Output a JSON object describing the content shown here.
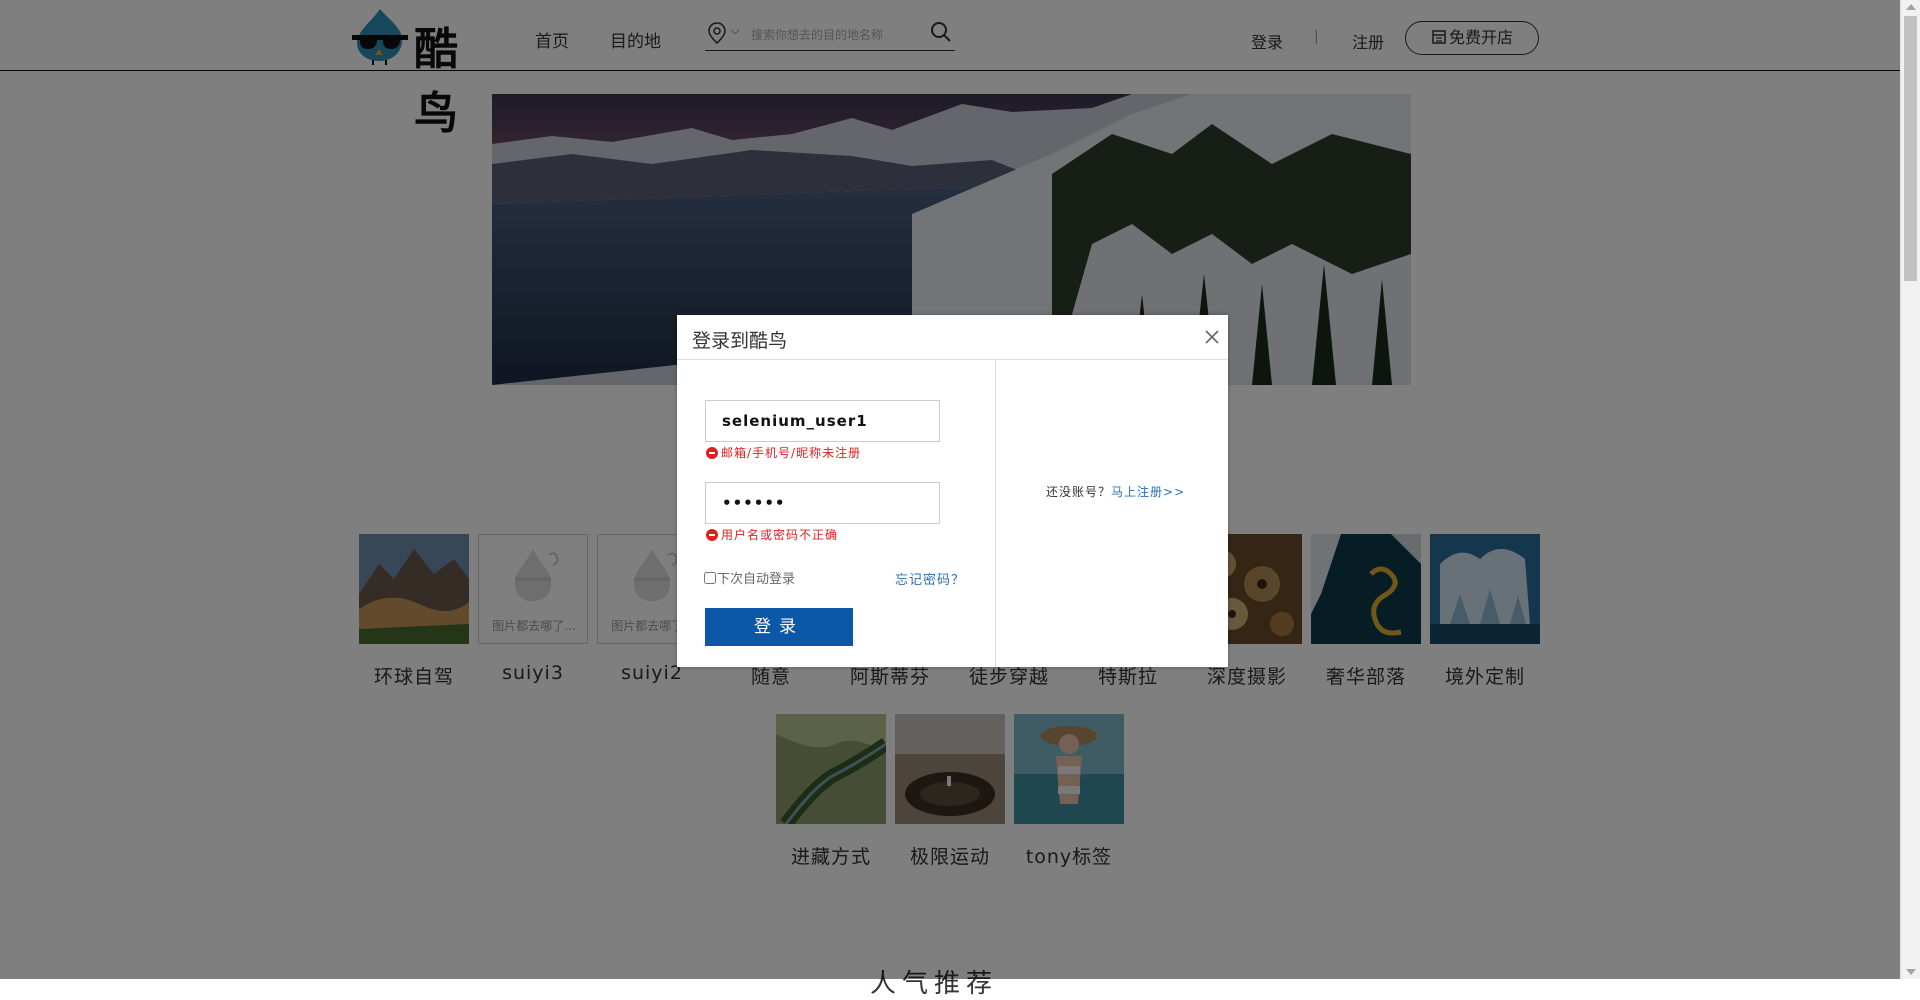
{
  "header": {
    "logo_text": "酷鸟",
    "nav": [
      "首页",
      "目的地"
    ],
    "search_placeholder": "搜索你想去的目的地名称",
    "login": "登录",
    "separator": "|",
    "register": "注册",
    "open_shop": "免费开店"
  },
  "tags": [
    {
      "label": "环球自驾",
      "image": "photo"
    },
    {
      "label": "suiyi3",
      "image": "placeholder",
      "caption": "图片都去哪了..."
    },
    {
      "label": "suiyi2",
      "image": "placeholder",
      "caption": "图片都去哪了..."
    },
    {
      "label": "随意",
      "image": "hidden"
    },
    {
      "label": "阿斯蒂芬",
      "image": "hidden"
    },
    {
      "label": "徒步穿越",
      "image": "hidden"
    },
    {
      "label": "特斯拉",
      "image": "hidden"
    },
    {
      "label": "深度摄影",
      "image": "photo"
    },
    {
      "label": "奢华部落",
      "image": "photo"
    },
    {
      "label": "境外定制",
      "image": "photo"
    },
    {
      "label": "进藏方式",
      "image": "photo"
    },
    {
      "label": "极限运动",
      "image": "photo"
    },
    {
      "label": "tony标签",
      "image": "photo"
    }
  ],
  "section_heading": "人气推荐",
  "login_modal": {
    "title": "登录到酷鸟",
    "username_value": "selenium_user1",
    "username_error": "邮箱/手机号/昵称未注册",
    "password_value": "••••••",
    "password_error": "用户名或密码不正确",
    "remember_label": "下次自动登录",
    "forgot_label": "忘记密码？",
    "submit_label": "登录",
    "no_account_text": "还没账号？",
    "register_now": "马上注册>>"
  },
  "colors": {
    "brand_blue": "#0b57a8",
    "link_blue": "#2a6fb3",
    "error_red": "#e02020",
    "logo_teal": "#2f8fb5"
  }
}
